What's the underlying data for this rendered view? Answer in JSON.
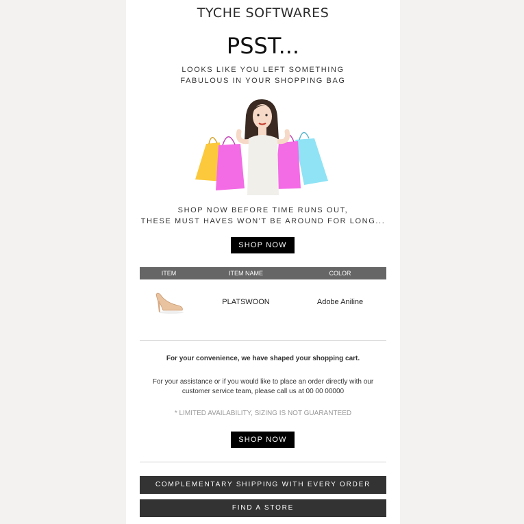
{
  "brand": "TYCHE SOFTWARES",
  "headline": "PSST...",
  "subline": [
    "LOOKS LIKE YOU LEFT SOMETHING",
    "FABULOUS IN YOUR SHOPPING BAG"
  ],
  "tagline": [
    "SHOP NOW BEFORE TIME RUNS OUT,",
    "THESE MUST HAVES WON'T BE AROUND FOR LONG..."
  ],
  "shop_now_label": "SHOP NOW",
  "table": {
    "headers": [
      "ITEM",
      "ITEM NAME",
      "COLOR"
    ],
    "rows": [
      {
        "name": "PLATSWOON",
        "color": "Adobe Aniline",
        "image_icon": "high-heel-shoe-icon"
      }
    ]
  },
  "convenience_text": "For your convenience, we have shaped your shopping cart.",
  "assistance_text": [
    "For your assistance or if you would like to place an order directly with our",
    "customer service team, please call us at 00 00 00000"
  ],
  "limited_text": "* LIMITED AVAILABILITY, SIZING IS NOT GUARANTEED",
  "footer_bars": [
    "COMPLEMENTARY SHIPPING WITH EVERY ORDER",
    "FIND A STORE"
  ],
  "colors": {
    "page_bg": "#f3f2f0",
    "button_bg": "#000000",
    "table_header_bg": "#666666",
    "footer_bar_bg": "#333333"
  }
}
